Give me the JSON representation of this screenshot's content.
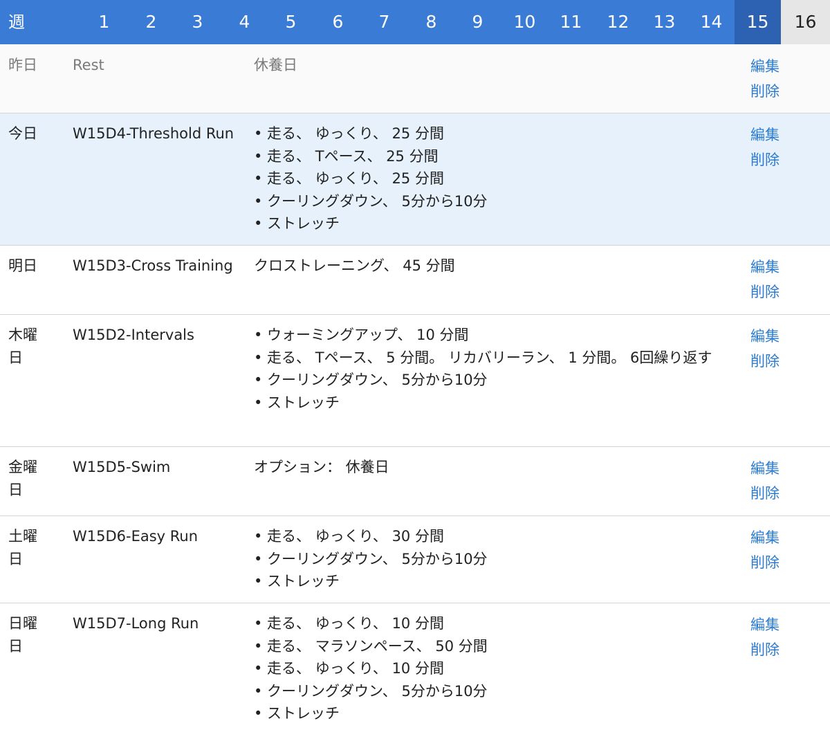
{
  "week_bar": {
    "label": "週",
    "weeks": [
      "1",
      "2",
      "3",
      "4",
      "5",
      "6",
      "7",
      "8",
      "9",
      "10",
      "11",
      "12",
      "13",
      "14",
      "15",
      "16"
    ],
    "current_week": "15"
  },
  "actions": {
    "edit": "編集",
    "delete": "削除"
  },
  "rows": [
    {
      "day": "昨日",
      "name": "Rest",
      "lines": [
        "休養日"
      ]
    },
    {
      "day": "今日",
      "name": "W15D4-Threshold Run",
      "lines": [
        "• 走る、 ゆっくり、 25 分間",
        "• 走る、 Tペース、 25 分間",
        "• 走る、 ゆっくり、 25 分間",
        "• クーリングダウン、 5分から10分",
        "• ストレッチ"
      ]
    },
    {
      "day": "明日",
      "name": "W15D3-Cross Training",
      "lines": [
        "クロストレーニング、 45 分間"
      ]
    },
    {
      "day": "木曜日",
      "name": "W15D2-Intervals",
      "lines": [
        "• ウォーミングアップ、 10 分間",
        "• 走る、 Tペース、 5 分間。 リカバリーラン、 1 分間。 6回繰り返す",
        "• クーリングダウン、 5分から10分",
        "• ストレッチ"
      ]
    },
    {
      "day": "金曜日",
      "name": "W15D5-Swim",
      "lines": [
        "オプション： 休養日"
      ]
    },
    {
      "day": "土曜日",
      "name": "W15D6-Easy Run",
      "lines": [
        "• 走る、 ゆっくり、 30 分間",
        "• クーリングダウン、 5分から10分",
        "• ストレッチ"
      ]
    },
    {
      "day": "日曜日",
      "name": "W15D7-Long Run",
      "lines": [
        "• 走る、 ゆっくり、 10 分間",
        "• 走る、 マラソンペース、 50 分間",
        "• 走る、 ゆっくり、 10 分間",
        "• クーリングダウン、 5分から10分",
        "• ストレッチ"
      ]
    }
  ]
}
